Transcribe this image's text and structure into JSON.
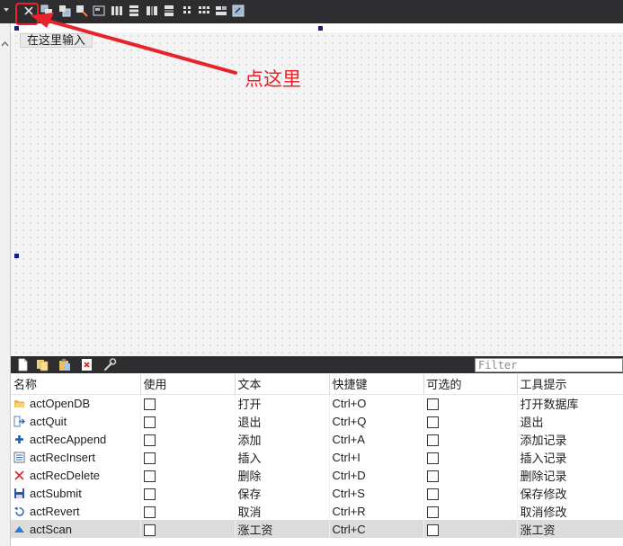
{
  "canvas": {
    "input_hint": "在这里输入"
  },
  "annotation": {
    "text": "点这里"
  },
  "action_editor": {
    "filter_placeholder": "Filter",
    "columns": [
      "名称",
      "使用",
      "文本",
      "快捷键",
      "可选的",
      "工具提示"
    ],
    "rows": [
      {
        "name": "actOpenDB",
        "icon": "folder-open-icon",
        "text": "打开",
        "shortcut": "Ctrl+O",
        "tooltip": "打开数据库"
      },
      {
        "name": "actQuit",
        "icon": "exit-icon",
        "text": "退出",
        "shortcut": "Ctrl+Q",
        "tooltip": "退出"
      },
      {
        "name": "actRecAppend",
        "icon": "plus-icon",
        "text": "添加",
        "shortcut": "Ctrl+A",
        "tooltip": "添加记录"
      },
      {
        "name": "actRecInsert",
        "icon": "insert-record-icon",
        "text": "插入",
        "shortcut": "Ctrl+I",
        "tooltip": "插入记录"
      },
      {
        "name": "actRecDelete",
        "icon": "delete-x-icon",
        "text": "删除",
        "shortcut": "Ctrl+D",
        "tooltip": "删除记录"
      },
      {
        "name": "actSubmit",
        "icon": "save-disk-icon",
        "text": "保存",
        "shortcut": "Ctrl+S",
        "tooltip": "保存修改"
      },
      {
        "name": "actRevert",
        "icon": "undo-arrow-icon",
        "text": "取消",
        "shortcut": "Ctrl+R",
        "tooltip": "取消修改"
      },
      {
        "name": "actScan",
        "icon": "triangle-up-icon",
        "text": "涨工资",
        "shortcut": "Ctrl+C",
        "tooltip": "涨工资"
      }
    ],
    "selected_row": 7
  },
  "colors": {
    "accent_red": "#e8232b",
    "toolbar_dark": "#2d2d30",
    "handle_blue": "#1a1a80",
    "selected_row": "#dcdcdc"
  }
}
